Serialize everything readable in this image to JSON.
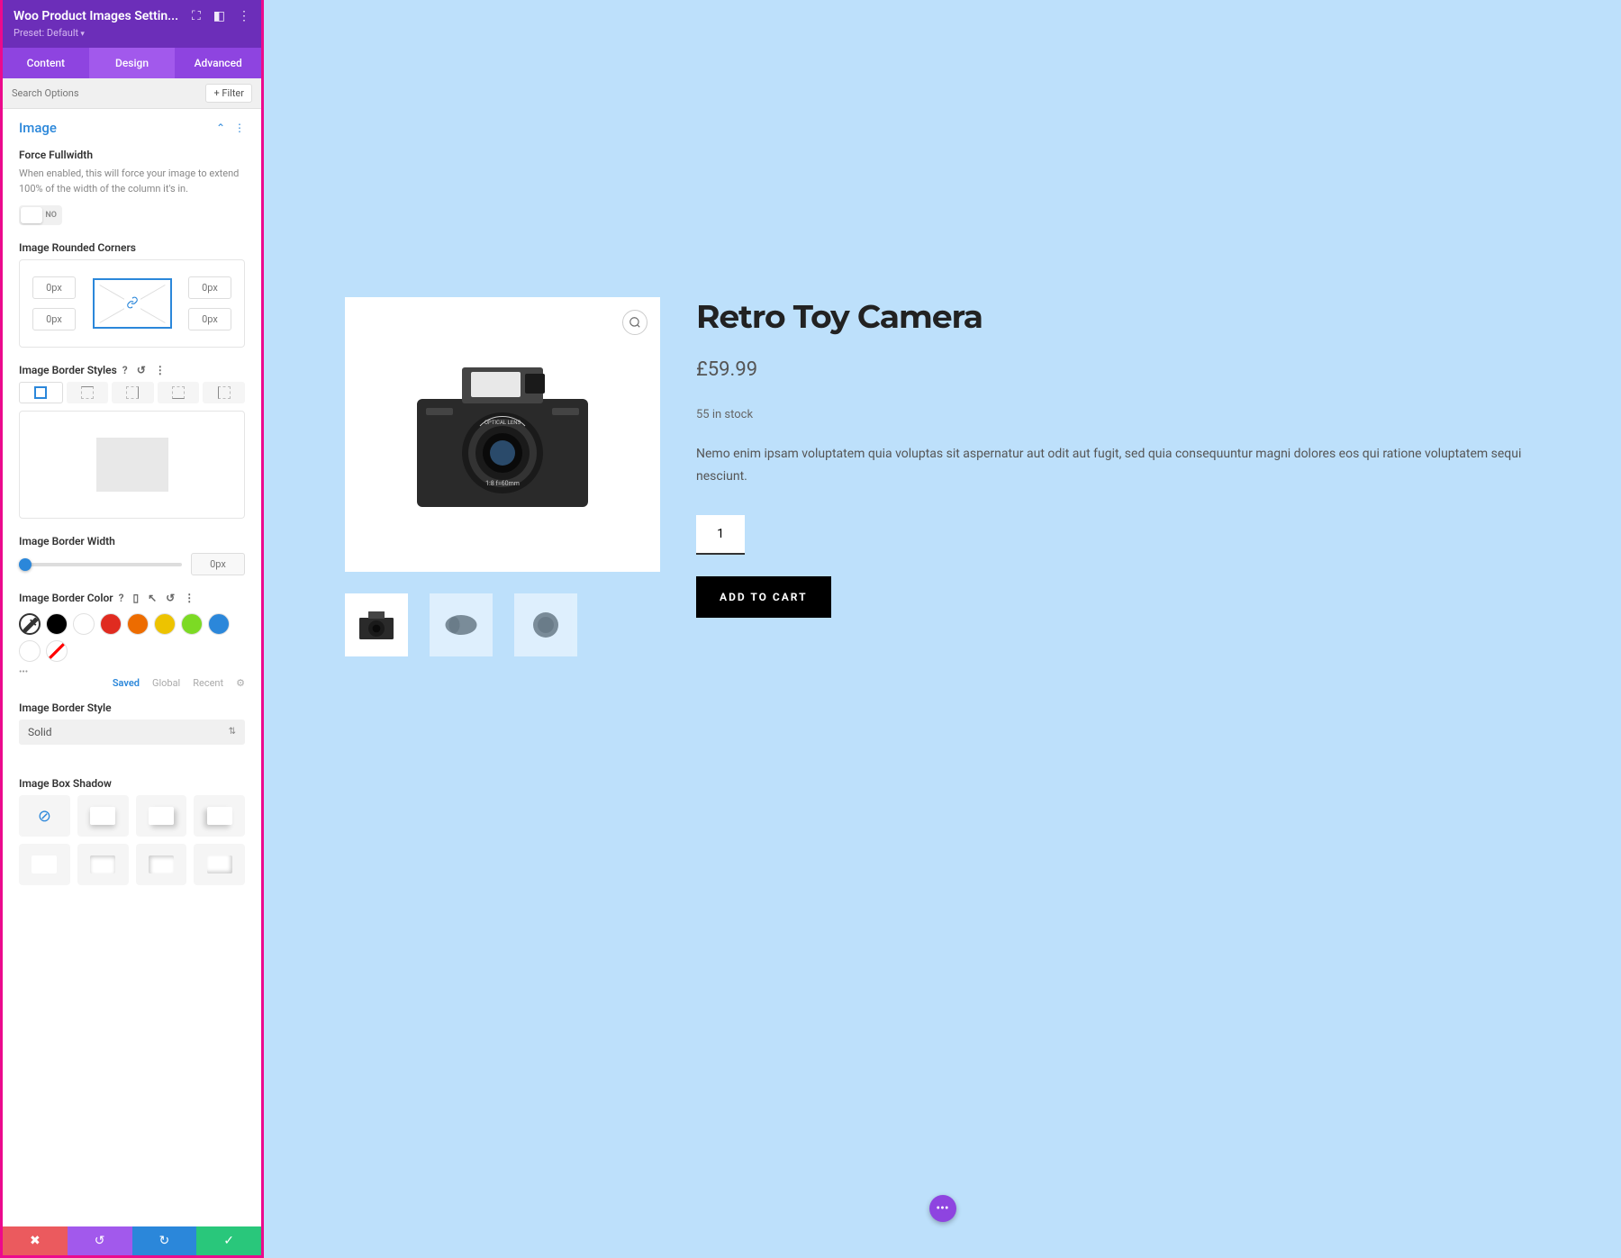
{
  "header": {
    "title": "Woo Product Images Settin...",
    "preset": "Preset: Default"
  },
  "tabs": [
    "Content",
    "Design",
    "Advanced"
  ],
  "active_tab": 1,
  "search": {
    "placeholder": "Search Options"
  },
  "filter_label": "+  Filter",
  "section": {
    "title": "Image",
    "force_fullwidth": {
      "label": "Force Fullwidth",
      "help": "When enabled, this will force your image to extend 100% of the width of the column it's in.",
      "value": "NO"
    },
    "rounded_corners": {
      "label": "Image Rounded Corners",
      "tl": "0px",
      "tr": "0px",
      "bl": "0px",
      "br": "0px"
    },
    "border_styles": {
      "label": "Image Border Styles"
    },
    "border_width": {
      "label": "Image Border Width",
      "value": "0px"
    },
    "border_color": {
      "label": "Image Border Color",
      "palette": [
        "#000000",
        "#ffffff",
        "#e02b20",
        "#ed6c00",
        "#edc300",
        "#7cda24",
        "#2b87da",
        "#ffffff"
      ],
      "tabs": [
        "Saved",
        "Global",
        "Recent"
      ]
    },
    "border_style": {
      "label": "Image Border Style",
      "value": "Solid"
    },
    "box_shadow": {
      "label": "Image Box Shadow"
    }
  },
  "product": {
    "title": "Retro Toy Camera",
    "price": "£59.99",
    "stock": "55 in stock",
    "desc": "Nemo enim ipsam voluptatem quia voluptas sit aspernatur aut odit aut fugit, sed quia consequuntur magni dolores eos qui ratione voluptatem sequi nesciunt.",
    "qty": "1",
    "add_button": "ADD TO CART"
  }
}
